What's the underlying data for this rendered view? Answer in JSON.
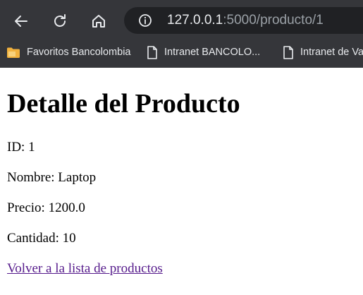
{
  "browser": {
    "url_host": "127.0.0.1",
    "url_path": ":5000/producto/1",
    "bookmarks": [
      {
        "label": "Favoritos Bancolombia",
        "icon": "folder-icon"
      },
      {
        "label": "Intranet BANCOLO...",
        "icon": "page-icon"
      },
      {
        "label": "Intranet de Va",
        "icon": "page-icon"
      }
    ]
  },
  "page": {
    "title": "Detalle del Producto",
    "fields": [
      {
        "label": "ID:",
        "value": "1"
      },
      {
        "label": "Nombre:",
        "value": "Laptop"
      },
      {
        "label": "Precio:",
        "value": "1200.0"
      },
      {
        "label": "Cantidad:",
        "value": "10"
      }
    ],
    "back_link": "Volver a la lista de productos"
  },
  "colors": {
    "toolbar": "#35363a",
    "omnibox": "#202124",
    "url_host": "#e8eaed",
    "url_path": "#9aa0a6",
    "visited_link": "#551a8b",
    "folder": "#f2b23e"
  }
}
